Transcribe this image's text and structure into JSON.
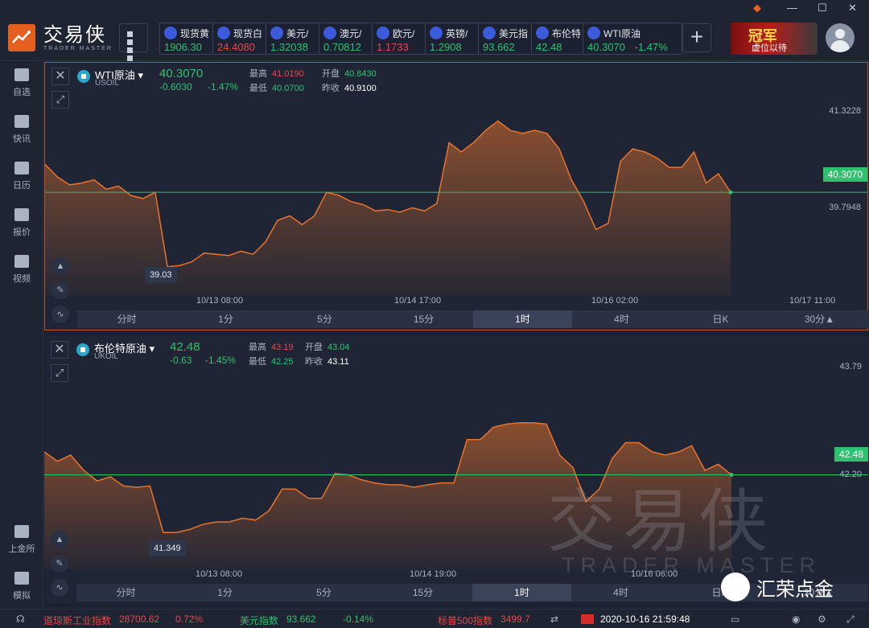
{
  "app": {
    "logo_cn": "交易侠",
    "logo_en": "TRADER MASTER"
  },
  "window": {
    "min_icon": "minimize-icon",
    "max_icon": "maximize-icon",
    "close_icon": "close-icon"
  },
  "tickers": [
    {
      "name": "现货黄",
      "value": "1906.30",
      "dir": "down",
      "icon": "gold-icon"
    },
    {
      "name": "现货白",
      "value": "24.4080",
      "dir": "up",
      "icon": "silver-icon"
    },
    {
      "name": "美元/",
      "value": "1.32038",
      "dir": "down",
      "icon": "flag-icon"
    },
    {
      "name": "澳元/",
      "value": "0.70812",
      "dir": "down",
      "icon": "flag-icon"
    },
    {
      "name": "欧元/",
      "value": "1.1733",
      "dir": "up",
      "icon": "flag-icon"
    },
    {
      "name": "英镑/",
      "value": "1.2908",
      "dir": "down",
      "icon": "flag-icon"
    },
    {
      "name": "美元指",
      "value": "93.662",
      "dir": "down",
      "icon": "flag-icon"
    },
    {
      "name": "布伦特",
      "value": "42.48",
      "dir": "down",
      "icon": "oil-icon"
    },
    {
      "name": "WTI原油",
      "value": "40.3070",
      "change": "-1.47%",
      "dir": "down",
      "icon": "oil-icon"
    }
  ],
  "ad": {
    "title": "冠军",
    "subtitle": "虚位以待"
  },
  "sidebar": [
    {
      "label": "自选",
      "icon": "star-icon"
    },
    {
      "label": "快讯",
      "icon": "news-icon"
    },
    {
      "label": "日历",
      "icon": "calendar-icon"
    },
    {
      "label": "报价",
      "icon": "quote-icon"
    },
    {
      "label": "视频",
      "icon": "video-icon"
    },
    {
      "label": "上金所",
      "icon": "exchange-icon"
    },
    {
      "label": "模拟",
      "icon": "simulate-icon"
    }
  ],
  "panel1": {
    "name": "WTI原油",
    "code": "USOIL",
    "price": "40.3070",
    "change": "-0.6030",
    "change_pct": "-1.47%",
    "high_label": "最高",
    "high": "41.0190",
    "low_label": "最低",
    "low": "40.0700",
    "open_label": "开盘",
    "open": "40.8430",
    "prev_label": "昨收",
    "prev": "40.9100",
    "min_tag": "39.03",
    "xticks": [
      "10/13 08:00",
      "10/14 17:00",
      "10/16 02:00",
      "10/17 11:00"
    ]
  },
  "panel2": {
    "name": "布伦特原油",
    "code": "UKOIL",
    "price": "42.48",
    "change": "-0.63",
    "change_pct": "-1.45%",
    "high_label": "最高",
    "high": "43.19",
    "low_label": "最低",
    "low": "42.25",
    "open_label": "开盘",
    "open": "43.04",
    "prev_label": "昨收",
    "prev": "43.11",
    "min_tag": "41.349",
    "xticks": [
      "10/13 08:00",
      "10/14 19:00",
      "10/16 06:00"
    ]
  },
  "timeframes": [
    "分时",
    "1分",
    "5分",
    "15分",
    "1时",
    "4时",
    "日K",
    "30分▲"
  ],
  "active_tf": 4,
  "watermark": {
    "cn": "交易侠",
    "en": "TRADER MASTER"
  },
  "wechat": {
    "text": "汇荣点金"
  },
  "status": {
    "dji_label": "道琼斯工业指数",
    "dji_value": "28700.62",
    "dji_change": "0.72%",
    "usd_label": "美元指数",
    "usd_value": "93.662",
    "usd_change": "-0.14%",
    "sp_label": "标普500指数",
    "sp_value": "3499.7",
    "datetime": "2020-10-16 21:59:48"
  },
  "chart_data": [
    {
      "type": "area",
      "title": "WTI原油",
      "ylim": [
        38.5,
        42.0
      ],
      "yticks": [
        "41.3228",
        "39.7948"
      ],
      "last": "40.3070",
      "values": [
        40.75,
        40.55,
        40.42,
        40.45,
        40.5,
        40.35,
        40.4,
        40.25,
        40.2,
        40.3,
        39.1,
        39.12,
        39.18,
        39.32,
        39.3,
        39.28,
        39.35,
        39.3,
        39.5,
        39.85,
        39.92,
        39.78,
        39.92,
        40.3,
        40.25,
        40.15,
        40.1,
        40.0,
        40.02,
        39.98,
        40.05,
        40.0,
        40.12,
        41.1,
        40.95,
        41.1,
        41.3,
        41.45,
        41.3,
        41.25,
        41.3,
        41.25,
        41.0,
        40.5,
        40.15,
        39.7,
        39.8,
        40.8,
        41.0,
        40.95,
        40.85,
        40.7,
        40.7,
        40.95,
        40.45,
        40.6,
        40.3
      ]
    },
    {
      "type": "area",
      "title": "布伦特原油",
      "ylim": [
        40.8,
        44.2
      ],
      "yticks": [
        "43.79",
        "42.20"
      ],
      "last": "42.48",
      "values": [
        42.85,
        42.7,
        42.8,
        42.55,
        42.38,
        42.45,
        42.3,
        42.28,
        42.3,
        41.55,
        41.55,
        41.6,
        41.68,
        41.72,
        41.72,
        41.78,
        41.75,
        41.9,
        42.25,
        42.25,
        42.1,
        42.1,
        42.5,
        42.48,
        42.4,
        42.35,
        42.32,
        42.32,
        42.28,
        42.32,
        42.35,
        42.35,
        43.05,
        43.05,
        43.25,
        43.3,
        43.32,
        43.32,
        43.3,
        42.8,
        42.6,
        42.05,
        42.25,
        42.75,
        43.0,
        43.0,
        42.85,
        42.8,
        42.85,
        42.95,
        42.55,
        42.65,
        42.48
      ]
    }
  ]
}
